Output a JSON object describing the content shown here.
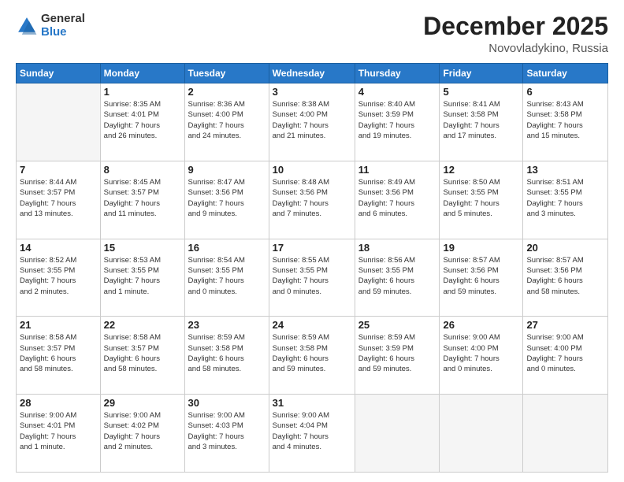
{
  "header": {
    "logo_general": "General",
    "logo_blue": "Blue",
    "month_title": "December 2025",
    "location": "Novovladykino, Russia"
  },
  "weekdays": [
    "Sunday",
    "Monday",
    "Tuesday",
    "Wednesday",
    "Thursday",
    "Friday",
    "Saturday"
  ],
  "weeks": [
    [
      {
        "day": "",
        "info": ""
      },
      {
        "day": "1",
        "info": "Sunrise: 8:35 AM\nSunset: 4:01 PM\nDaylight: 7 hours\nand 26 minutes."
      },
      {
        "day": "2",
        "info": "Sunrise: 8:36 AM\nSunset: 4:00 PM\nDaylight: 7 hours\nand 24 minutes."
      },
      {
        "day": "3",
        "info": "Sunrise: 8:38 AM\nSunset: 4:00 PM\nDaylight: 7 hours\nand 21 minutes."
      },
      {
        "day": "4",
        "info": "Sunrise: 8:40 AM\nSunset: 3:59 PM\nDaylight: 7 hours\nand 19 minutes."
      },
      {
        "day": "5",
        "info": "Sunrise: 8:41 AM\nSunset: 3:58 PM\nDaylight: 7 hours\nand 17 minutes."
      },
      {
        "day": "6",
        "info": "Sunrise: 8:43 AM\nSunset: 3:58 PM\nDaylight: 7 hours\nand 15 minutes."
      }
    ],
    [
      {
        "day": "7",
        "info": "Sunrise: 8:44 AM\nSunset: 3:57 PM\nDaylight: 7 hours\nand 13 minutes."
      },
      {
        "day": "8",
        "info": "Sunrise: 8:45 AM\nSunset: 3:57 PM\nDaylight: 7 hours\nand 11 minutes."
      },
      {
        "day": "9",
        "info": "Sunrise: 8:47 AM\nSunset: 3:56 PM\nDaylight: 7 hours\nand 9 minutes."
      },
      {
        "day": "10",
        "info": "Sunrise: 8:48 AM\nSunset: 3:56 PM\nDaylight: 7 hours\nand 7 minutes."
      },
      {
        "day": "11",
        "info": "Sunrise: 8:49 AM\nSunset: 3:56 PM\nDaylight: 7 hours\nand 6 minutes."
      },
      {
        "day": "12",
        "info": "Sunrise: 8:50 AM\nSunset: 3:55 PM\nDaylight: 7 hours\nand 5 minutes."
      },
      {
        "day": "13",
        "info": "Sunrise: 8:51 AM\nSunset: 3:55 PM\nDaylight: 7 hours\nand 3 minutes."
      }
    ],
    [
      {
        "day": "14",
        "info": "Sunrise: 8:52 AM\nSunset: 3:55 PM\nDaylight: 7 hours\nand 2 minutes."
      },
      {
        "day": "15",
        "info": "Sunrise: 8:53 AM\nSunset: 3:55 PM\nDaylight: 7 hours\nand 1 minute."
      },
      {
        "day": "16",
        "info": "Sunrise: 8:54 AM\nSunset: 3:55 PM\nDaylight: 7 hours\nand 0 minutes."
      },
      {
        "day": "17",
        "info": "Sunrise: 8:55 AM\nSunset: 3:55 PM\nDaylight: 7 hours\nand 0 minutes."
      },
      {
        "day": "18",
        "info": "Sunrise: 8:56 AM\nSunset: 3:55 PM\nDaylight: 6 hours\nand 59 minutes."
      },
      {
        "day": "19",
        "info": "Sunrise: 8:57 AM\nSunset: 3:56 PM\nDaylight: 6 hours\nand 59 minutes."
      },
      {
        "day": "20",
        "info": "Sunrise: 8:57 AM\nSunset: 3:56 PM\nDaylight: 6 hours\nand 58 minutes."
      }
    ],
    [
      {
        "day": "21",
        "info": "Sunrise: 8:58 AM\nSunset: 3:57 PM\nDaylight: 6 hours\nand 58 minutes."
      },
      {
        "day": "22",
        "info": "Sunrise: 8:58 AM\nSunset: 3:57 PM\nDaylight: 6 hours\nand 58 minutes."
      },
      {
        "day": "23",
        "info": "Sunrise: 8:59 AM\nSunset: 3:58 PM\nDaylight: 6 hours\nand 58 minutes."
      },
      {
        "day": "24",
        "info": "Sunrise: 8:59 AM\nSunset: 3:58 PM\nDaylight: 6 hours\nand 59 minutes."
      },
      {
        "day": "25",
        "info": "Sunrise: 8:59 AM\nSunset: 3:59 PM\nDaylight: 6 hours\nand 59 minutes."
      },
      {
        "day": "26",
        "info": "Sunrise: 9:00 AM\nSunset: 4:00 PM\nDaylight: 7 hours\nand 0 minutes."
      },
      {
        "day": "27",
        "info": "Sunrise: 9:00 AM\nSunset: 4:00 PM\nDaylight: 7 hours\nand 0 minutes."
      }
    ],
    [
      {
        "day": "28",
        "info": "Sunrise: 9:00 AM\nSunset: 4:01 PM\nDaylight: 7 hours\nand 1 minute."
      },
      {
        "day": "29",
        "info": "Sunrise: 9:00 AM\nSunset: 4:02 PM\nDaylight: 7 hours\nand 2 minutes."
      },
      {
        "day": "30",
        "info": "Sunrise: 9:00 AM\nSunset: 4:03 PM\nDaylight: 7 hours\nand 3 minutes."
      },
      {
        "day": "31",
        "info": "Sunrise: 9:00 AM\nSunset: 4:04 PM\nDaylight: 7 hours\nand 4 minutes."
      },
      {
        "day": "",
        "info": ""
      },
      {
        "day": "",
        "info": ""
      },
      {
        "day": "",
        "info": ""
      }
    ]
  ]
}
